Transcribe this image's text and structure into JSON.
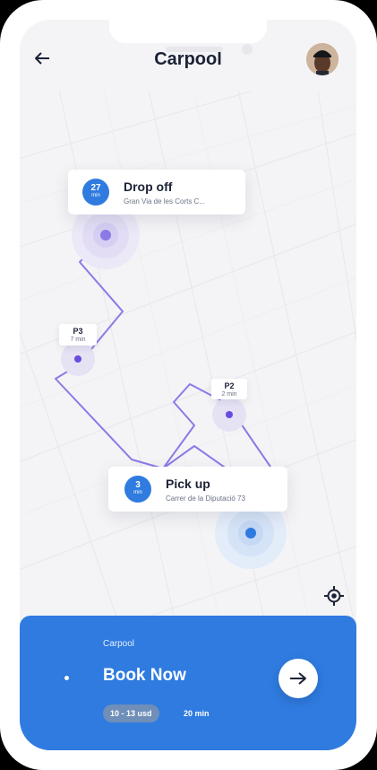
{
  "header": {
    "title": "Carpool",
    "back_icon": "arrow-left-icon",
    "avatar_icon": "user-avatar"
  },
  "map": {
    "dropoff": {
      "eta_value": "27",
      "eta_unit": "min",
      "title": "Drop off",
      "address": "Gran Via de les Corts C..."
    },
    "pickup": {
      "eta_value": "3",
      "eta_unit": "min",
      "title": "Pick up",
      "address": "Carrer de la Diputació 73"
    },
    "stops": [
      {
        "label": "P3",
        "time": "7 min"
      },
      {
        "label": "P2",
        "time": "2 min"
      }
    ],
    "locate_icon": "crosshair-icon"
  },
  "sheet": {
    "label": "Carpool",
    "action": "Book Now",
    "price": "10 - 13 usd",
    "duration": "20 min",
    "go_icon": "arrow-right-icon"
  },
  "colors": {
    "accent": "#2f7be0",
    "route": "#8a7be6",
    "dot": "#6a4be0"
  }
}
